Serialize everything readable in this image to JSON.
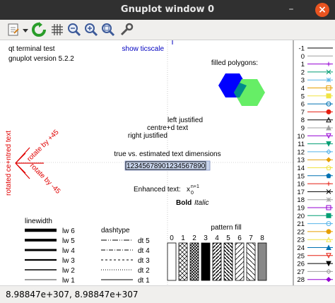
{
  "window": {
    "title": "Gnuplot window 0",
    "minimize_glyph": "–",
    "close_glyph": "×"
  },
  "toolbar": {
    "icons": [
      "export-icon",
      "dropdown-arrow-icon",
      "replot-icon",
      "grid-icon",
      "zoom-back-icon",
      "zoom-forward-icon",
      "zoom-fit-icon",
      "settings-icon"
    ]
  },
  "plot": {
    "header1": "qt  terminal test",
    "header2": "gnuplot version 5.2.2",
    "show_ticscale": "show ticscale",
    "filled_polygons": "filled polygons:",
    "left_justified": "left justified",
    "centred_text": "centre+d text",
    "right_justified": "right justified",
    "rotated_centred": "rotated ce+ntred text",
    "rotate_pos45": "rotate by +45",
    "rotate_neg45": "rotate by -45",
    "text_dimensions": "true vs. estimated text dimensions",
    "number_box": "12345678901234567890",
    "enhanced_label": "Enhanced text:",
    "enhanced_x": "x",
    "enhanced_sub": "0",
    "enhanced_sup": "n+1",
    "bold": "Bold",
    "italic": "Italic",
    "linewidth_title": "linewidth",
    "lw_labels": [
      "lw 6",
      "lw 5",
      "lw 4",
      "lw 3",
      "lw 2",
      "lw 1"
    ],
    "dashtype_title": "dashtype",
    "dt_labels": [
      "dt 5",
      "dt 4",
      "dt 3",
      "dt 2",
      "dt 1"
    ],
    "pattern_title": "pattern fill",
    "pattern_labels": [
      "0",
      "1",
      "2",
      "3",
      "4",
      "5",
      "6",
      "7",
      "8"
    ],
    "legend": [
      {
        "label": "-1",
        "color": "#000000",
        "marker": "none"
      },
      {
        "label": "0",
        "color": "#a0a0a0",
        "marker": "none"
      },
      {
        "label": "1",
        "color": "#9400d3",
        "marker": "+"
      },
      {
        "label": "2",
        "color": "#009e73",
        "marker": "x"
      },
      {
        "label": "3",
        "color": "#56b4e9",
        "marker": "*"
      },
      {
        "label": "4",
        "color": "#e69f00",
        "marker": "sq"
      },
      {
        "label": "5",
        "color": "#f0e442",
        "marker": "fsq"
      },
      {
        "label": "6",
        "color": "#0072b2",
        "marker": "o"
      },
      {
        "label": "7",
        "color": "#e51e10",
        "marker": "fo"
      },
      {
        "label": "8",
        "color": "#000000",
        "marker": "tri"
      },
      {
        "label": "9",
        "color": "#a0a0a0",
        "marker": "ftri"
      },
      {
        "label": "10",
        "color": "#9400d3",
        "marker": "itri"
      },
      {
        "label": "11",
        "color": "#009e73",
        "marker": "fitri"
      },
      {
        "label": "12",
        "color": "#56b4e9",
        "marker": "dia"
      },
      {
        "label": "13",
        "color": "#e69f00",
        "marker": "fdia"
      },
      {
        "label": "14",
        "color": "#f0e442",
        "marker": "pent"
      },
      {
        "label": "15",
        "color": "#0072b2",
        "marker": "fpent"
      },
      {
        "label": "16",
        "color": "#e51e10",
        "marker": "+"
      },
      {
        "label": "17",
        "color": "#000000",
        "marker": "x"
      },
      {
        "label": "18",
        "color": "#a0a0a0",
        "marker": "*"
      },
      {
        "label": "19",
        "color": "#9400d3",
        "marker": "sq"
      },
      {
        "label": "20",
        "color": "#009e73",
        "marker": "fsq"
      },
      {
        "label": "21",
        "color": "#56b4e9",
        "marker": "o"
      },
      {
        "label": "22",
        "color": "#e69f00",
        "marker": "fo"
      },
      {
        "label": "23",
        "color": "#f0e442",
        "marker": "tri"
      },
      {
        "label": "24",
        "color": "#0072b2",
        "marker": "ftri"
      },
      {
        "label": "25",
        "color": "#e51e10",
        "marker": "itri"
      },
      {
        "label": "26",
        "color": "#000000",
        "marker": "fitri"
      },
      {
        "label": "27",
        "color": "#a0a0a0",
        "marker": "dia"
      },
      {
        "label": "28",
        "color": "#9400d3",
        "marker": "fdia"
      }
    ],
    "colors": {
      "blue_hexagon": "#0000ff",
      "green_hexagon": "#66ee66",
      "overlap": "#008b8b",
      "rotated_text": "#e00000",
      "ticscale_text": "#0000c0"
    }
  },
  "status": {
    "coordinates": "8.98847e+307, 8.98847e+307"
  }
}
